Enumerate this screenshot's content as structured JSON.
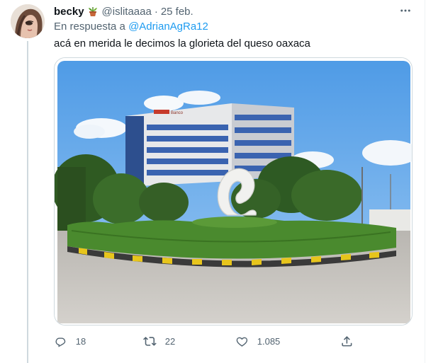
{
  "tweet": {
    "author": {
      "display_name": "becky",
      "name_emoji": "potted-plant-icon",
      "handle": "@islitaaaa",
      "separator": "·",
      "time": "25 feb."
    },
    "reply": {
      "prefix": "En respuesta a",
      "to_handle": "@AdrianAgRa12"
    },
    "text": "acá en merida le decimos la glorieta del queso oaxaca",
    "media": {
      "alt": "",
      "sign_text": "Banco"
    },
    "actions": {
      "reply": {
        "icon": "reply-icon",
        "count": "18"
      },
      "retweet": {
        "icon": "retweet-icon",
        "count": "22"
      },
      "like": {
        "icon": "heart-icon",
        "count": "1.085"
      },
      "share": {
        "icon": "share-icon"
      }
    },
    "more_icon": "more-icon"
  },
  "colors": {
    "link": "#1d9bf0",
    "secondary": "#536471",
    "text": "#0f1419",
    "border": "#cfd9de"
  }
}
